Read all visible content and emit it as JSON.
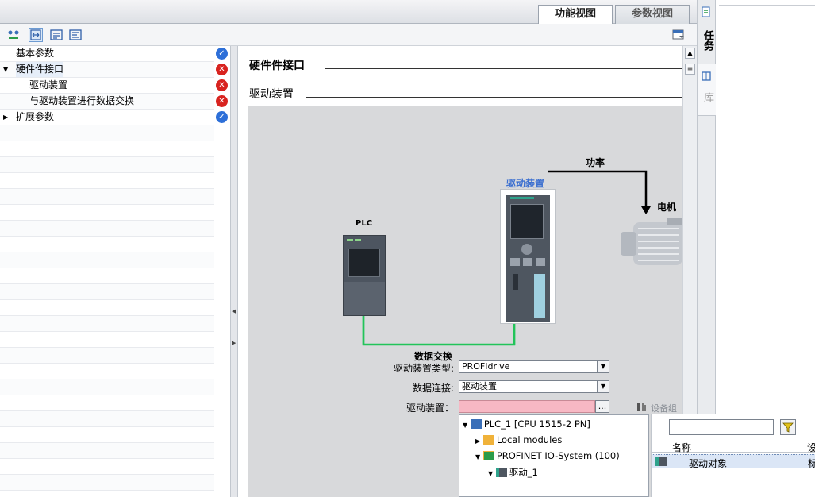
{
  "view_tabs": {
    "function_view": "功能视图",
    "parameter_view": "参数视图"
  },
  "side_tabs": {
    "tasks": "任务",
    "library": "库"
  },
  "nav": {
    "items": [
      {
        "label": "基本参数",
        "status": "ok"
      },
      {
        "label": "硬件件接口",
        "status": "error",
        "expanded": true
      },
      {
        "label": "驱动装置",
        "status": "error"
      },
      {
        "label": "与驱动装置进行数据交换",
        "status": "error"
      },
      {
        "label": "扩展参数",
        "status": "ok",
        "expanded": false
      }
    ]
  },
  "content": {
    "section_title": "硬件件接口",
    "subsection_title": "驱动装置"
  },
  "diagram": {
    "drive_label": "驱动装置",
    "plc_label": "PLC",
    "power_label": "功率",
    "motor_label": "电机",
    "data_exchange_label": "数据交换"
  },
  "form": {
    "drive_type_label": "驱动装置类型:",
    "drive_type_value": "PROFIdrive",
    "data_connection_label": "数据连接:",
    "data_connection_value": "驱动装置",
    "drive_label": "驱动装置：",
    "drive_value": "",
    "browse_label": "...",
    "device_hint": "设备组"
  },
  "tree": {
    "items": [
      {
        "label": "PLC_1 [CPU 1515-2 PN]",
        "expanded": true
      },
      {
        "label": "Local modules",
        "expanded": false
      },
      {
        "label": "PROFINET IO-System (100)",
        "expanded": true
      },
      {
        "label": "驱动_1",
        "expanded": true
      }
    ]
  },
  "right_panel": {
    "search_value": "",
    "column_name": "名称",
    "column_2": "设",
    "row_name": "驱动对象",
    "row_col2": "标"
  },
  "colors": {
    "error": "#d8231f",
    "ok": "#2d6fd8",
    "link_green": "#22c45a",
    "drive_label": "#3b6fd0",
    "invalid_field": "#f7b8c4"
  }
}
